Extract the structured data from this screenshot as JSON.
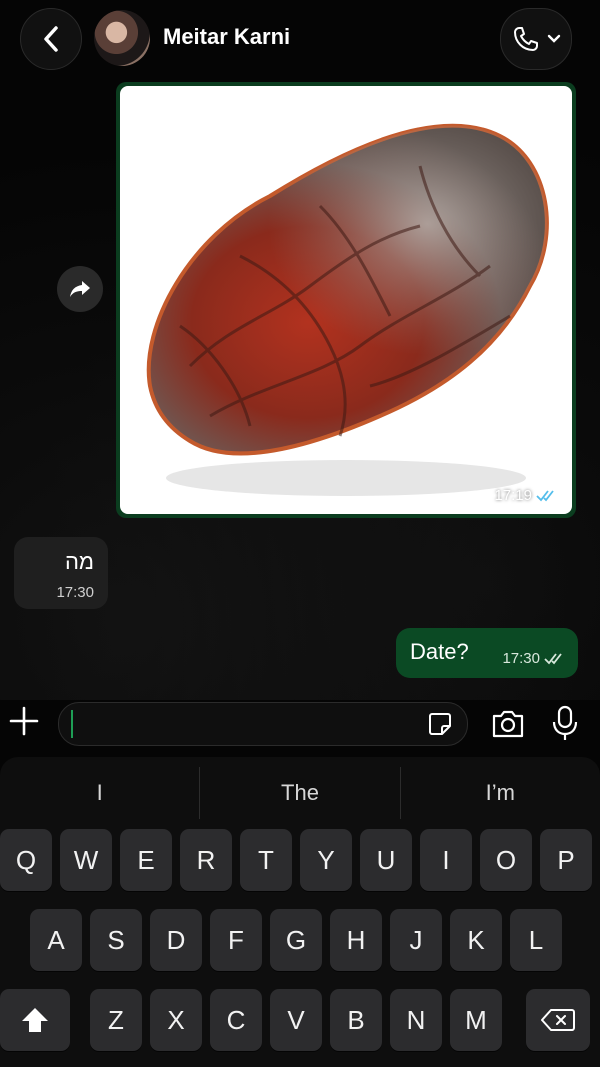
{
  "header": {
    "contact_name": "Meitar Karni",
    "back_icon": "chevron-left-icon",
    "call_icon": "phone-icon",
    "call_menu_icon": "chevron-down-icon"
  },
  "messages": [
    {
      "type": "image",
      "direction": "outgoing",
      "time": "17:19",
      "status": "read"
    },
    {
      "type": "text",
      "direction": "incoming",
      "text": "מה",
      "time": "17:30"
    },
    {
      "type": "text",
      "direction": "outgoing",
      "text": "Date?",
      "time": "17:30",
      "status": "delivered"
    }
  ],
  "input": {
    "value": "",
    "placeholder": ""
  },
  "keyboard": {
    "suggestions": [
      "I",
      "The",
      "I’m"
    ],
    "row1": [
      "Q",
      "W",
      "E",
      "R",
      "T",
      "Y",
      "U",
      "I",
      "O",
      "P"
    ],
    "row2": [
      "A",
      "S",
      "D",
      "F",
      "G",
      "H",
      "J",
      "K",
      "L"
    ],
    "row3": [
      "Z",
      "X",
      "C",
      "V",
      "B",
      "N",
      "M"
    ]
  },
  "colors": {
    "outgoing_bubble": "#0b4a24",
    "incoming_bubble": "#1f1f1f",
    "read_tick": "#53bdeb",
    "caret": "#1e9e55"
  }
}
